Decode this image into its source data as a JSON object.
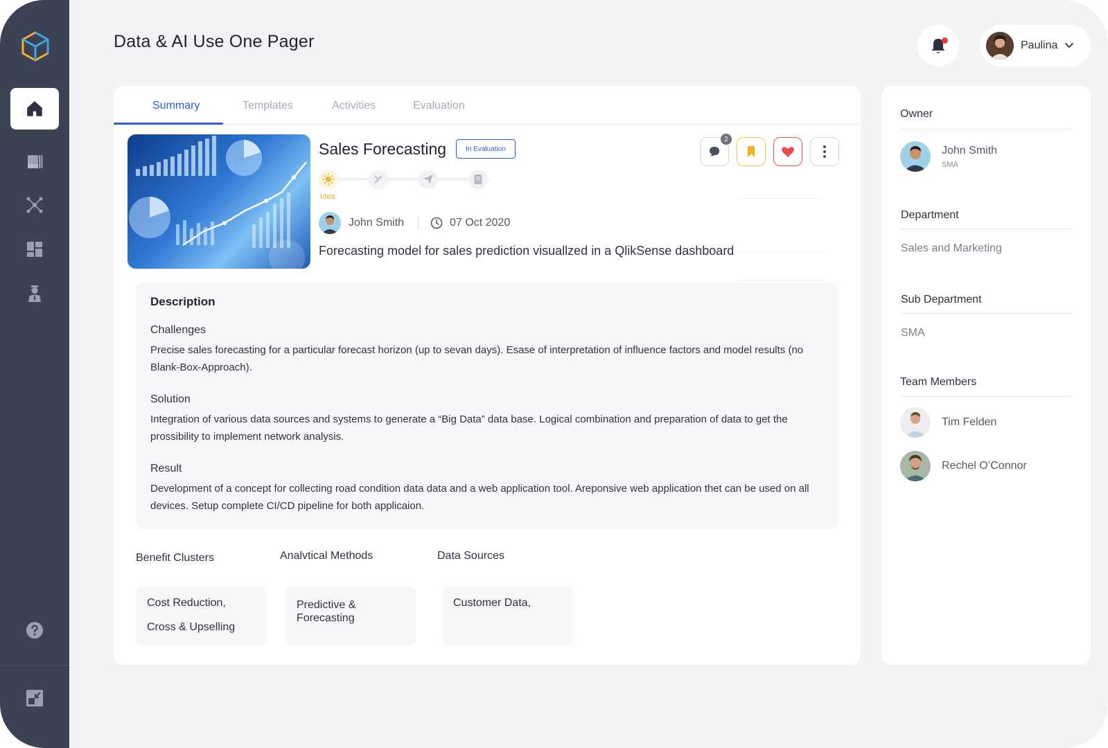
{
  "header": {
    "title": "Data & AI Use One Pager",
    "user_name": "Paulina"
  },
  "sidebar": {
    "items": [
      {
        "icon": "home-icon",
        "active": true
      },
      {
        "icon": "documents-icon",
        "active": false
      },
      {
        "icon": "network-icon",
        "active": false
      },
      {
        "icon": "dashboard-icon",
        "active": false
      },
      {
        "icon": "user-tie-icon",
        "active": false
      }
    ],
    "bottom": [
      "help-icon",
      "collapse-icon"
    ]
  },
  "tabs": [
    {
      "label": "Summary",
      "active": true
    },
    {
      "label": "Templates",
      "active": false
    },
    {
      "label": "Activities",
      "active": false
    },
    {
      "label": "Evaluation",
      "active": false
    }
  ],
  "project": {
    "title": "Sales Forecasting",
    "status": "In Evaluation",
    "comment_count": "2",
    "stage_label": "Idea",
    "author": "John Smith",
    "date": "07 Oct 2020",
    "summary": "Forecasting model for sales prediction visuallzed in a QlikSense dashboard"
  },
  "description": {
    "heading": "Description",
    "challenges_title": "Challenges",
    "challenges_text": "Precise sales forecasting for a particular forecast horizon (up to sevan days). Esase of interpretation of influence factors and model results (no Blank-Box-Approach).",
    "solution_title": "Solution",
    "solution_text": "Integration of various data sources and systems to generate a “Big Data” data base. Logical combination and preparation of data to get the prossibility to implement  network analysis.",
    "result_title": "Result",
    "result_text": "Development of a concept for collecting road condition data data and a web application tool. Areponsive web application thet can be used on all devices. Setup complete CI/CD pipeline for both applicaion."
  },
  "tags": {
    "benefit_label": "Benefit Clusters",
    "benefit_values": [
      "Cost Reduction,",
      "Cross & Upselling"
    ],
    "methods_label": "Analvtical Methods",
    "methods_values": [
      "Predictive &",
      "Forecasting"
    ],
    "sources_label": "Data Sources",
    "sources_values": [
      "Customer Data,"
    ]
  },
  "side": {
    "owner_label": "Owner",
    "owner_name": "John Smith",
    "owner_sub": "SMA",
    "department_label": "Department",
    "department_value": "Sales and Marketing",
    "subdepartment_label": "Sub Department",
    "subdepartment_value": "SMA",
    "team_label": "Team Members",
    "team": [
      "Tim Felden",
      "Rechel O’Connor"
    ]
  },
  "colors": {
    "sidebar_bg": "#3b4254",
    "accent": "#2d5bd8",
    "page_bg": "#f3f3f5",
    "stage_active": "#f0a92d",
    "heart": "#ef4b4b",
    "bookmark": "#f3c64a"
  }
}
